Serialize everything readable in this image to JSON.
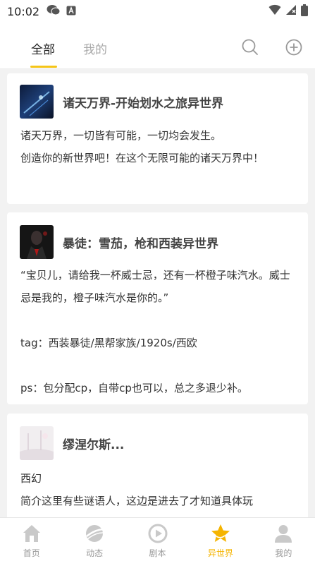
{
  "status_bar": {
    "time": "10:02"
  },
  "header": {
    "tabs": [
      {
        "label": "全部",
        "active": true
      },
      {
        "label": "我的",
        "active": false
      }
    ],
    "accent_color": "#f5c518"
  },
  "feed": {
    "cards": [
      {
        "title": "诸天万界-开始划水之旅异世界",
        "body": "诸天万界，一切皆有可能，一切均会发生。\n创造你的新世界吧！在这个无限可能的诸天万界中！"
      },
      {
        "title": "暴徒：雪茄，枪和西装异世界",
        "body": "“宝贝儿，请给我一杯威士忌，还有一杯橙子味汽水。威士忌是我的，橙子味汽水是你的。”\n\ntag：西装暴徒/黑帮家族/1920s/西欧\n\nps：包分配cp，自带cp也可以，总之多退少补。"
      },
      {
        "title": "缪涅尔斯...",
        "body": "西幻\n简介这里有些谜语人，这边是进去了才知道具体玩"
      }
    ]
  },
  "bottom_nav": {
    "items": [
      {
        "label": "首页",
        "icon": "home-icon"
      },
      {
        "label": "动态",
        "icon": "planet-icon"
      },
      {
        "label": "剧本",
        "icon": "play-icon"
      },
      {
        "label": "异世界",
        "icon": "star-icon",
        "active": true
      },
      {
        "label": "我的",
        "icon": "person-icon"
      }
    ],
    "active_color": "#f5b400"
  }
}
